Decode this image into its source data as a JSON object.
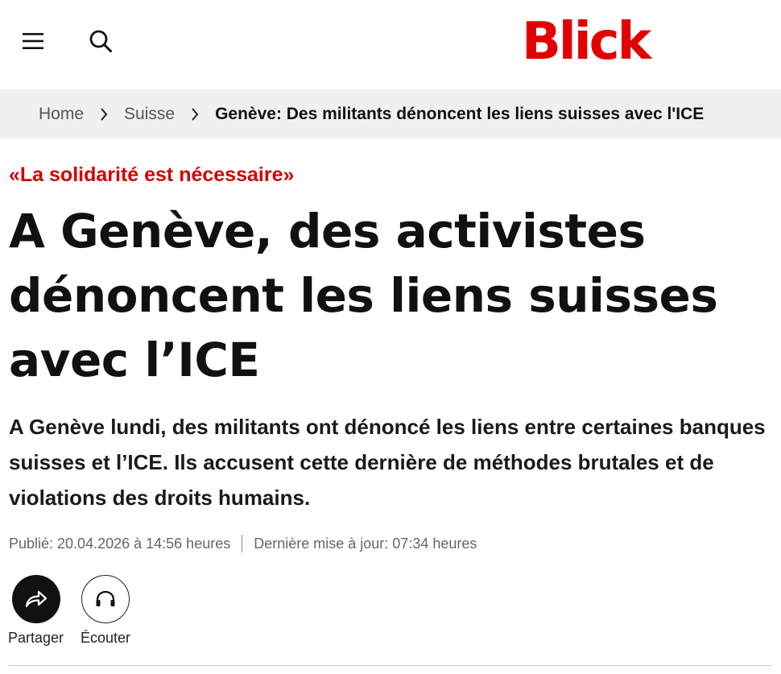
{
  "header": {
    "logo": "Blick",
    "menu_icon": "hamburger-menu-icon",
    "search_icon": "search-icon",
    "brand_color": "#e20000"
  },
  "breadcrumb": {
    "items": [
      "Home",
      "Suisse"
    ],
    "current": "Genève: Des militants dénoncent les liens suisses avec l'ICE"
  },
  "article": {
    "kicker": "«La solidarité est nécessaire»",
    "kicker_color": "#d20000",
    "headline": "A Genève, des activistes dénoncent les liens suisses avec l’ICE",
    "lead": "A Genève lundi, des militants ont dénoncé les liens entre certaines banques suisses et l’ICE. Ils accusent cette dernière de méthodes brutales et de violations des droits humains.",
    "published": "Publié: 20.04.2026 à 14:56 heures",
    "updated": "Dernière mise à jour: 07:34 heures"
  },
  "actions": {
    "share_label": "Partager",
    "share_icon": "share-arrow-icon",
    "listen_label": "Écouter",
    "listen_icon": "headphones-icon"
  }
}
